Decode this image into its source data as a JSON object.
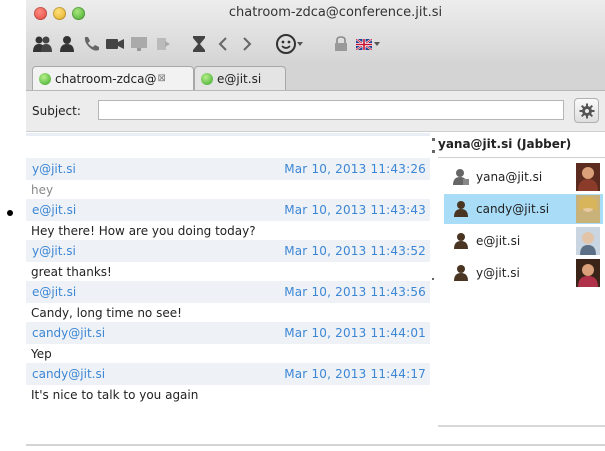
{
  "window": {
    "title": "chatroom-zdca@conference.jit.si"
  },
  "toolbar": {
    "icons": [
      "invite-users-icon",
      "user-icon",
      "phone-icon",
      "video-camera-icon",
      "desktop-share-icon",
      "send-file-icon",
      "hourglass-icon",
      "back-icon",
      "forward-icon",
      "smiley-icon",
      "lock-icon",
      "flag-icon"
    ]
  },
  "tabs": [
    {
      "label": "chatroom-zdca@",
      "close": "⊠",
      "active": true
    },
    {
      "label": "e@jit.si",
      "active": false
    }
  ],
  "subject": {
    "label": "Subject:",
    "value": ""
  },
  "messages": [
    {
      "sender": "y@jit.si",
      "time": "Mar 10, 2013 11:43:26",
      "text": "hey",
      "faded": true
    },
    {
      "sender": "e@jit.si",
      "time": "Mar 10, 2013 11:43:43",
      "text": "Hey there! How are you doing today?",
      "faded": false
    },
    {
      "sender": "y@jit.si",
      "time": "Mar 10, 2013 11:43:52",
      "text": "great thanks!",
      "faded": false
    },
    {
      "sender": "e@jit.si",
      "time": "Mar 10, 2013 11:43:56",
      "text": "Candy, long time no see!",
      "faded": false
    },
    {
      "sender": "candy@jit.si",
      "time": "Mar 10, 2013 11:44:01",
      "text": "Yep",
      "faded": false
    },
    {
      "sender": "candy@jit.si",
      "time": "Mar 10, 2013 11:44:17",
      "text": "It's nice to talk to you again",
      "faded": false
    }
  ],
  "occupants": {
    "header": "yana@jit.si (Jabber)",
    "items": [
      {
        "name": "yana@jit.si",
        "selected": false,
        "icon": "grey-user-icon"
      },
      {
        "name": "candy@jit.si",
        "selected": true,
        "icon": "brown-user-icon"
      },
      {
        "name": "e@jit.si",
        "selected": false,
        "icon": "brown-user-icon"
      },
      {
        "name": "y@jit.si",
        "selected": false,
        "icon": "brown-user-icon"
      }
    ]
  },
  "colors": {
    "sender": "#3c86d4",
    "selection": "#a9dcf7",
    "header_row": "#eef2f7"
  }
}
